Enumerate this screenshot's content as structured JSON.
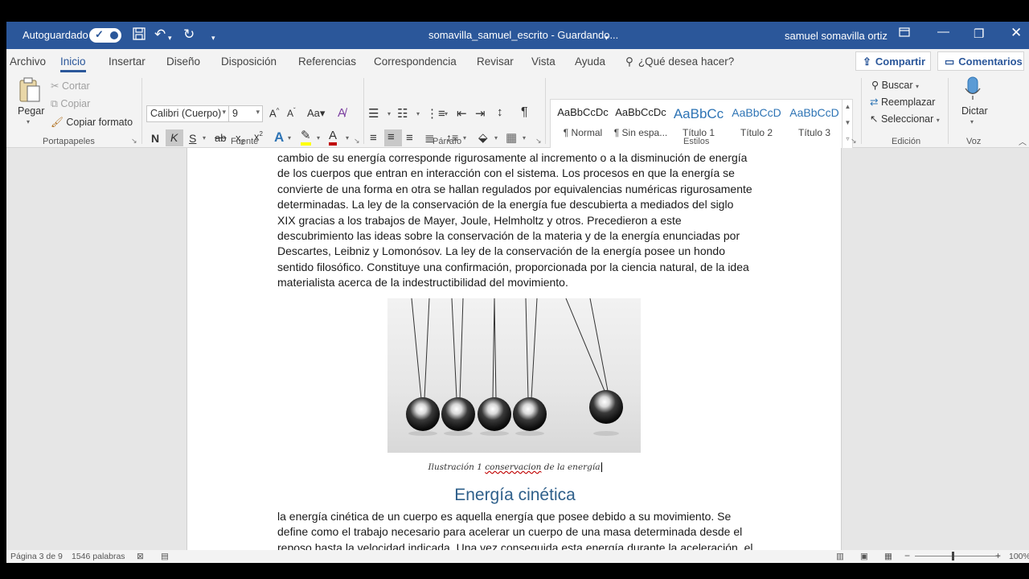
{
  "titlebar": {
    "autosave_label": "Autoguardado",
    "doc_title": "somavilla_samuel_escrito  -  Guardando...",
    "user": "samuel somavilla ortiz"
  },
  "tabs": [
    "Archivo",
    "Inicio",
    "Insertar",
    "Diseño",
    "Disposición",
    "Referencias",
    "Correspondencia",
    "Revisar",
    "Vista",
    "Ayuda"
  ],
  "tell_me": "¿Qué desea hacer?",
  "share_label": "Compartir",
  "comments_label": "Comentarios",
  "clipboard": {
    "paste": "Pegar",
    "cut": "Cortar",
    "copy": "Copiar",
    "format_painter": "Copiar formato",
    "group": "Portapapeles"
  },
  "font": {
    "family": "Calibri (Cuerpo)",
    "size": "9",
    "bold": "N",
    "italic": "K",
    "underline": "S",
    "strike": "ab",
    "group": "Fuente"
  },
  "paragraph_group": "Párrafo",
  "styles": {
    "group": "Estilos",
    "items": [
      {
        "preview": "AaBbCcDc",
        "name": "¶ Normal"
      },
      {
        "preview": "AaBbCcDc",
        "name": "¶ Sin espa..."
      },
      {
        "preview": "AaBbCc",
        "name": "Título 1"
      },
      {
        "preview": "AaBbCcD",
        "name": "Título 2"
      },
      {
        "preview": "AaBbCcD",
        "name": "Título 3"
      }
    ]
  },
  "editing": {
    "find": "Buscar",
    "replace": "Reemplazar",
    "select": "Seleccionar",
    "group": "Edición"
  },
  "voice": {
    "dictate": "Dictar",
    "group": "Voz"
  },
  "document": {
    "paragraph1": "cambio de su energía corresponde rigurosamente al incremento o a la disminución de energía de los cuerpos que entran en interacción con el sistema. Los procesos en que la energía se convierte de una forma en otra se hallan regulados por equivalencias numéricas rigurosamente determinadas. La ley de la conservación de la energía fue descubierta a mediados del siglo XIX gracias a los trabajos de Mayer, Joule, Helmholtz y otros. Precedieron a este descubrimiento las ideas sobre la conservación de la materia y de la energía enunciadas por Descartes, Leibniz y Lomonósov. La ley de la conservación de la energía posee un hondo sentido filosófico. Constituye una confirmación, proporcionada por la ciencia natural, de la idea materialista acerca de la indestructibilidad del movimiento.",
    "caption_a": "Ilustración 1 ",
    "caption_b": "conservacion",
    "caption_c": " de la energía",
    "heading": "Energía cinética",
    "paragraph2": " la energía cinética de un cuerpo es aquella energía que posee debido a su movimiento. Se define como el trabajo necesario para acelerar un cuerpo de una masa determinada desde el reposo hasta la velocidad indicada. Una vez conseguida esta energía durante la aceleración, el cuerpo mantiene"
  },
  "status": {
    "page": "Página 3 de 9",
    "words": "1546 palabras",
    "zoom": "100%"
  }
}
